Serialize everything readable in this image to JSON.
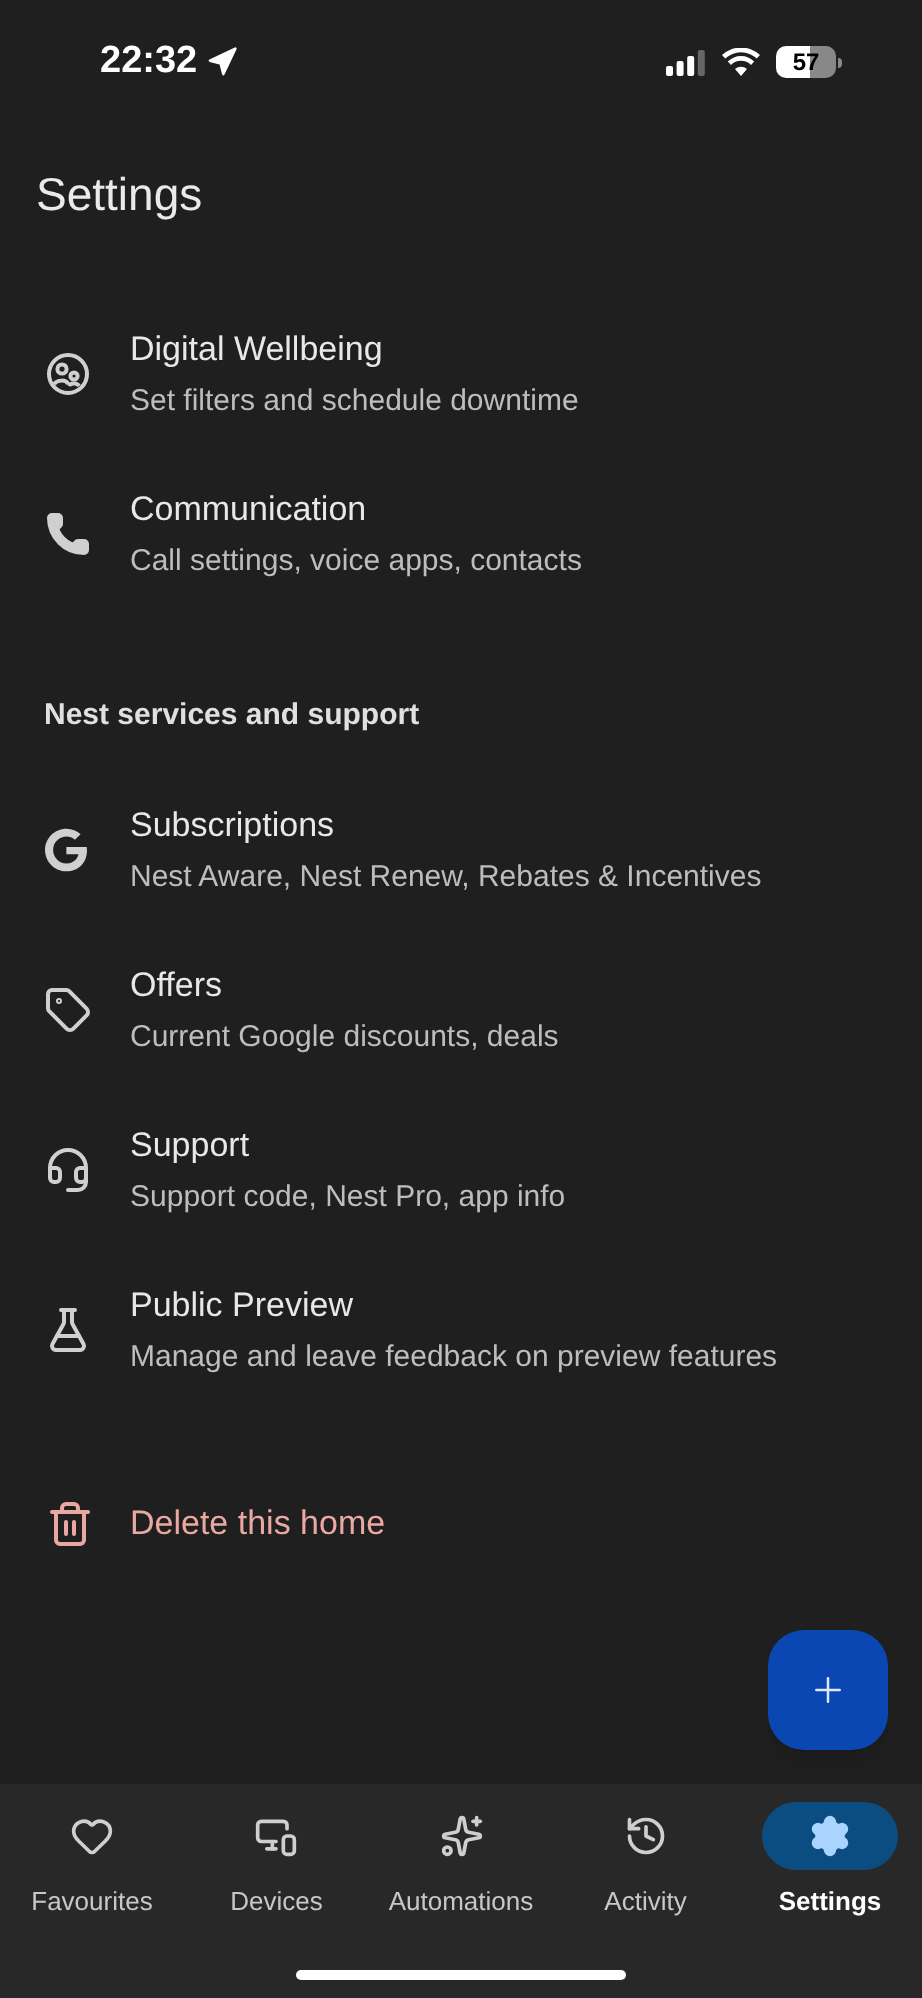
{
  "status_bar": {
    "time": "22:32",
    "battery": "57"
  },
  "title": "Settings",
  "top_items": [
    {
      "title": "Digital Wellbeing",
      "subtitle": "Set filters and schedule downtime"
    },
    {
      "title": "Communication",
      "subtitle": "Call settings, voice apps, contacts"
    }
  ],
  "section": {
    "heading": "Nest services and support",
    "items": [
      {
        "title": "Subscriptions",
        "subtitle": "Nest Aware, Nest Renew, Rebates & Incentives"
      },
      {
        "title": "Offers",
        "subtitle": "Current Google discounts, deals"
      },
      {
        "title": "Support",
        "subtitle": "Support code, Nest Pro, app info"
      },
      {
        "title": "Public Preview",
        "subtitle": "Manage and leave feedback on preview features"
      }
    ]
  },
  "delete_action": {
    "label": "Delete this home"
  },
  "bottom_nav": [
    {
      "label": "Favourites",
      "selected": false
    },
    {
      "label": "Devices",
      "selected": false
    },
    {
      "label": "Automations",
      "selected": false
    },
    {
      "label": "Activity",
      "selected": false
    },
    {
      "label": "Settings",
      "selected": true
    }
  ]
}
